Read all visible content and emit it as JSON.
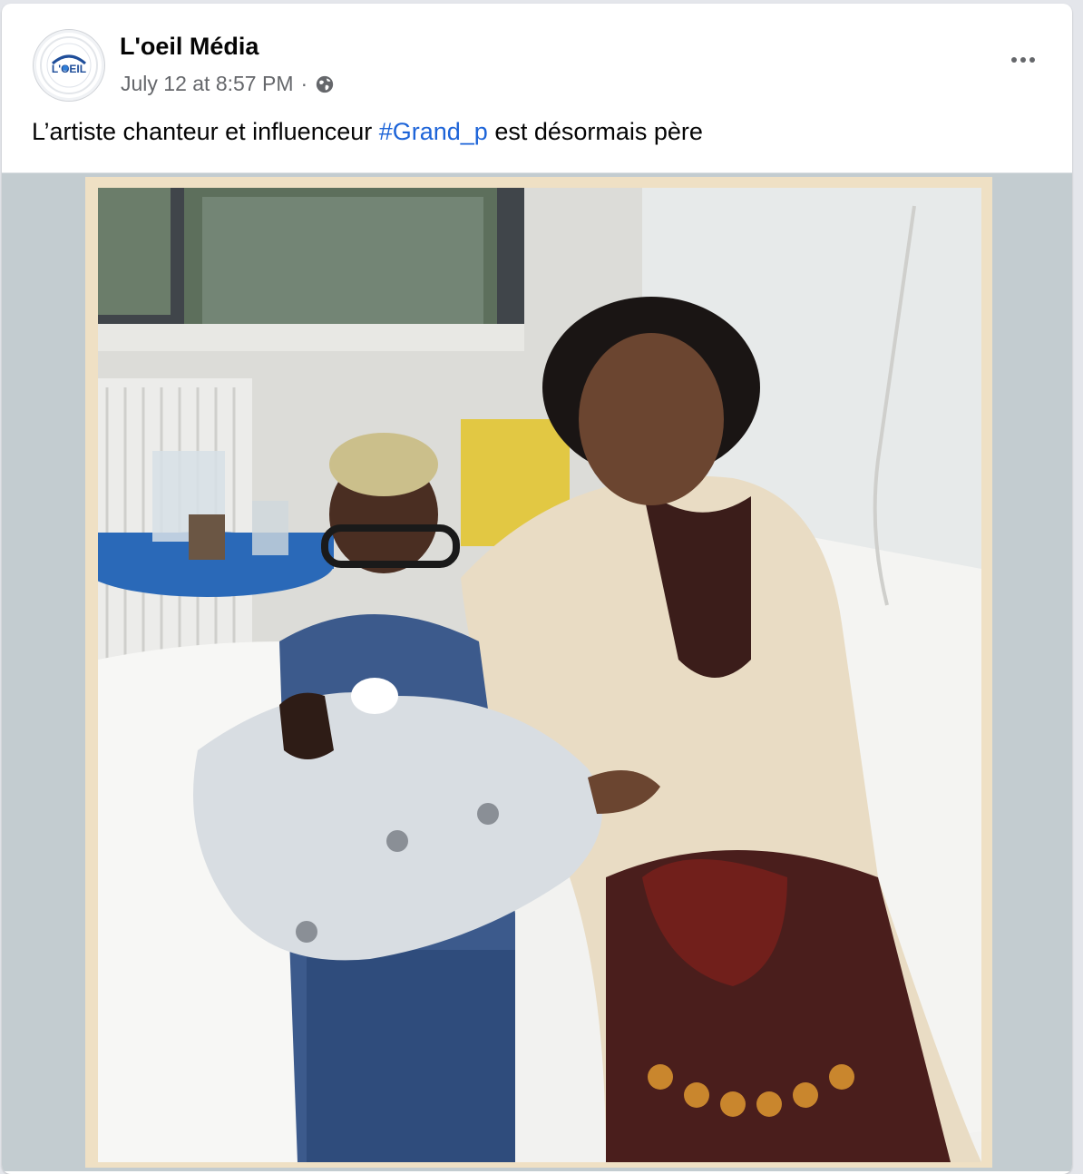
{
  "post": {
    "page_name": "L'oeil Média",
    "timestamp": "July 12 at 8:57 PM",
    "separator": "·",
    "audience_icon": "globe-icon",
    "more_icon": "more-options-icon",
    "avatar_logo_text": "L'OEIL",
    "caption": {
      "before": "L’artiste chanteur et influenceur ",
      "hashtag": "#Grand_p",
      "after": " est désormais père"
    },
    "photo_description_icon": "photo"
  },
  "colors": {
    "link": "#1d64d8",
    "secondary_text": "#65676b",
    "primary_text": "#050505",
    "logo_blue": "#1f4e9a"
  }
}
